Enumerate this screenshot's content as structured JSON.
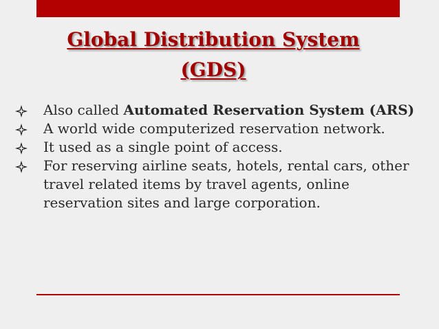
{
  "slide": {
    "title_line1": "Global Distribution System",
    "title_line2": "(GDS)",
    "bullets": [
      {
        "text_plain": "Also called ",
        "text_bold": "Automated Reservation System (ARS)"
      },
      {
        "text": "A world wide computerized reservation network."
      },
      {
        "text": "It used as a single point of access."
      },
      {
        "text": "For reserving airline seats, hotels, rental cars, other travel related items by travel agents, online reservation sites and large corporation."
      }
    ],
    "bullet_icon": "diamond-bullet-icon"
  },
  "colors": {
    "background": "#efefef",
    "accent_red": "#b30000",
    "title_red": "#a30000",
    "text": "#2a2a2a"
  }
}
